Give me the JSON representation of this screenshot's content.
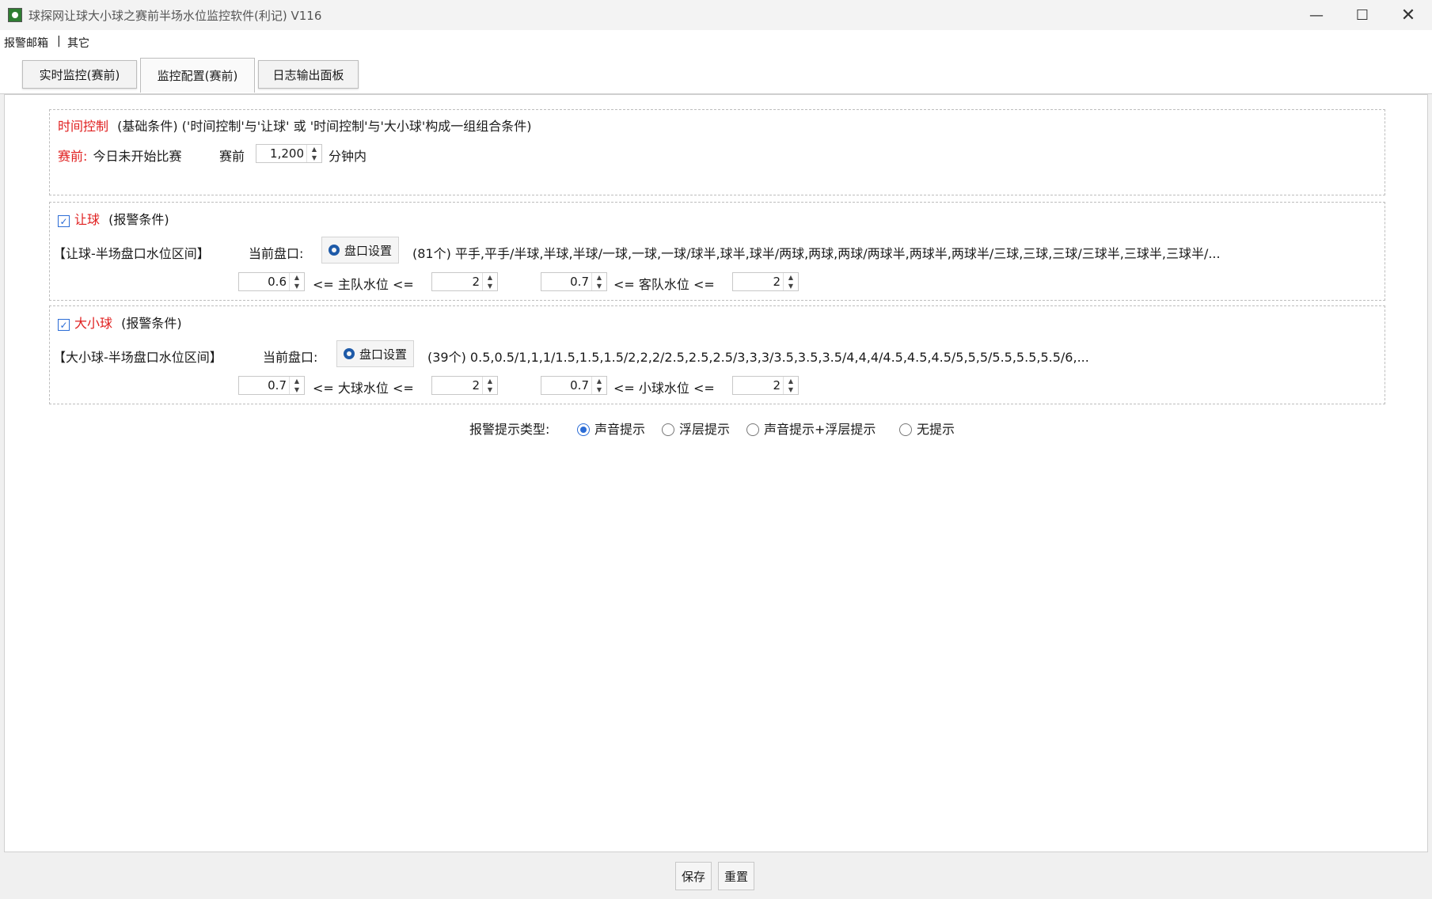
{
  "window": {
    "title": "球探网让球大小球之赛前半场水位监控软件(利记) V116",
    "minimize": "—",
    "maximize": "☐",
    "close": "✕"
  },
  "menu": {
    "items": [
      "报警邮箱",
      "|",
      "其它"
    ]
  },
  "tabs": [
    {
      "label": "实时监控(赛前)",
      "active": false
    },
    {
      "label": "监控配置(赛前)",
      "active": true
    },
    {
      "label": "日志输出面板",
      "active": false
    }
  ],
  "time_control": {
    "title": "时间控制",
    "desc": "(基础条件) ('时间控制'与'让球' 或 '时间控制'与'大小球'构成一组组合条件)",
    "pre_label": "赛前:",
    "pre_text": "今日未开始比赛",
    "before_label": "赛前",
    "minutes_value": "1,200",
    "minutes_unit": "分钟内"
  },
  "handicap": {
    "checked": true,
    "title": "让球",
    "desc": "(报警条件)",
    "range_label": "【让球-半场盘口水位区间】",
    "current_label": "当前盘口:",
    "settings_button": "盘口设置",
    "current_value": "(81个) 平手,平手/半球,半球,半球/一球,一球,一球/球半,球半,球半/两球,两球,两球/两球半,两球半,两球半/三球,三球,三球/三球半,三球半,三球半/...",
    "home_min": "0.6",
    "home_label": "<= 主队水位 <=",
    "home_max": "2",
    "away_min": "0.7",
    "away_label": "<= 客队水位 <=",
    "away_max": "2"
  },
  "overunder": {
    "checked": true,
    "title": "大小球",
    "desc": "(报警条件)",
    "range_label": "【大小球-半场盘口水位区间】",
    "current_label": "当前盘口:",
    "settings_button": "盘口设置",
    "current_value": "(39个) 0.5,0.5/1,1,1/1.5,1.5,1.5/2,2,2/2.5,2.5,2.5/3,3,3/3.5,3.5,3.5/4,4,4/4.5,4.5,4.5/5,5,5/5.5,5.5,5.5/6,...",
    "over_min": "0.7",
    "over_label": "<= 大球水位 <=",
    "over_max": "2",
    "under_min": "0.7",
    "under_label": "<= 小球水位 <=",
    "under_max": "2"
  },
  "alert": {
    "label": "报警提示类型:",
    "options": [
      "声音提示",
      "浮层提示",
      "声音提示+浮层提示",
      "无提示"
    ],
    "selected": "声音提示"
  },
  "footer": {
    "save": "保存",
    "reset": "重置"
  }
}
